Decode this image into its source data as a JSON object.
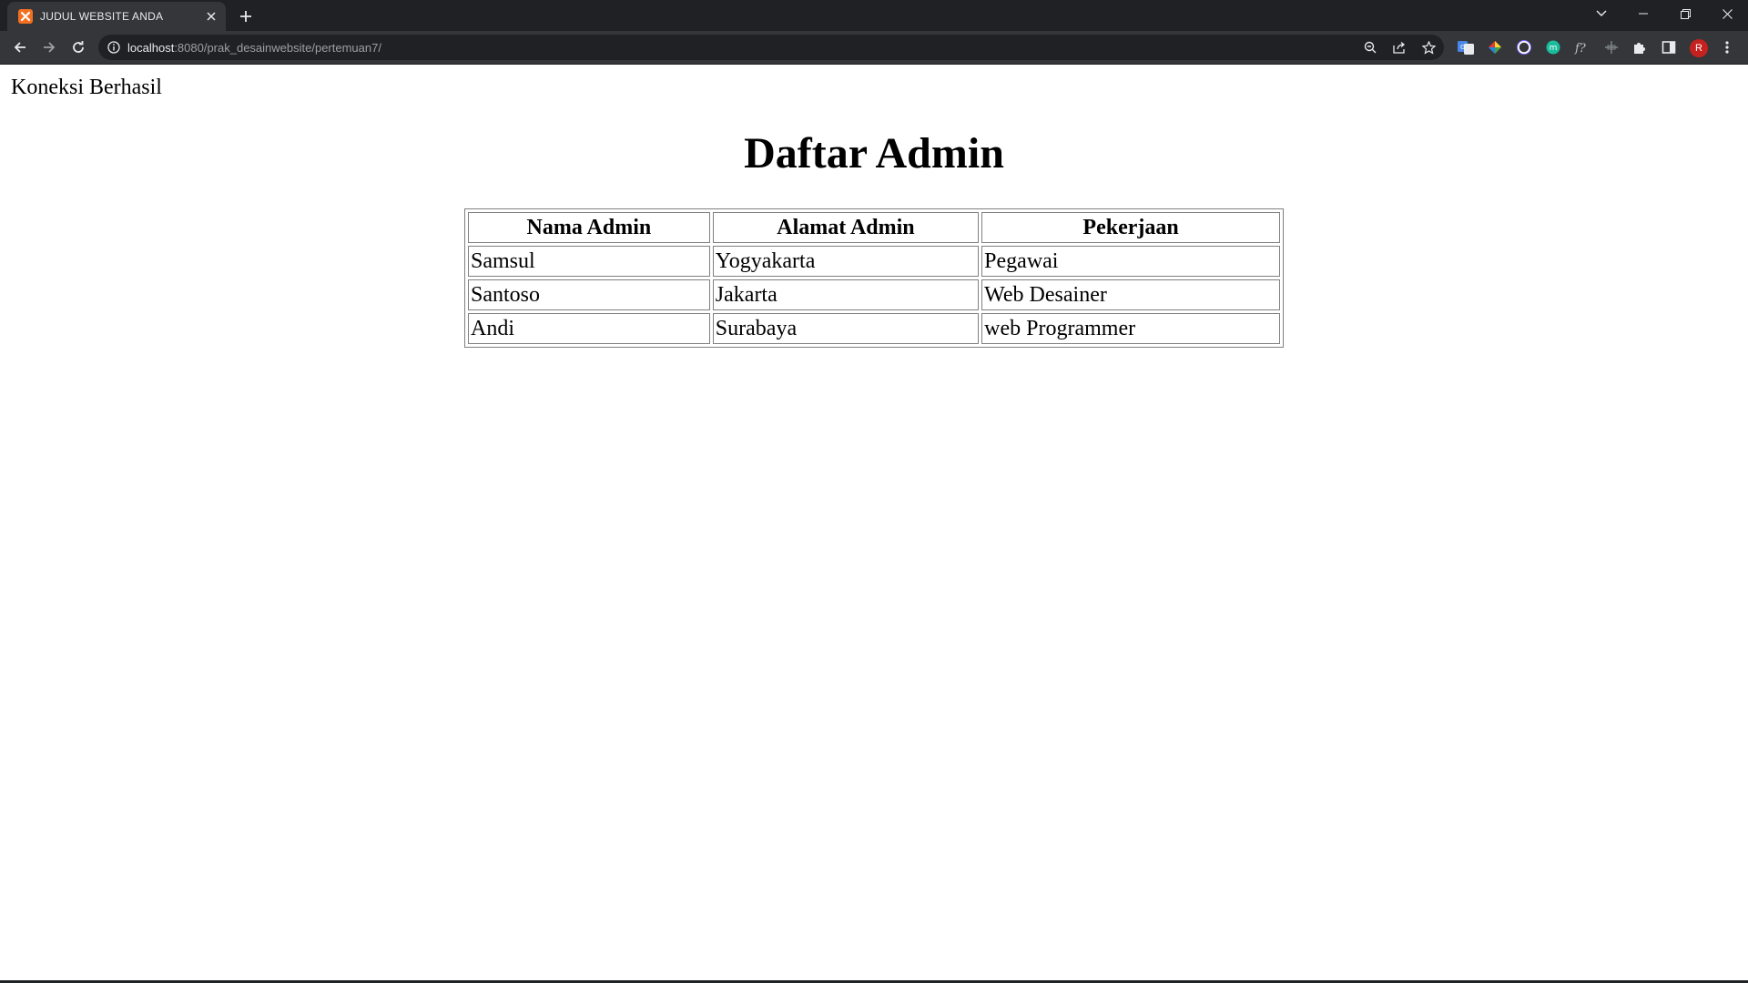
{
  "browser": {
    "tab_title": "JUDUL WEBSITE ANDA",
    "url_host": "localhost",
    "url_rest": ":8080/prak_desainwebsite/pertemuan7/",
    "avatar_letter": "R",
    "icons": {
      "favicon": "xampp-favicon-icon",
      "back": "arrow-left-icon",
      "forward": "arrow-right-icon",
      "reload": "reload-icon",
      "site_info": "info-icon",
      "zoom": "zoom-icon",
      "share": "share-icon",
      "bookmark": "star-icon",
      "extensions": [
        "translate-icon",
        "color-picker-icon",
        "circle-extension-icon",
        "m-extension-icon",
        "font-extension-icon",
        "ruler-extension-icon",
        "puzzle-icon",
        "side-panel-icon"
      ],
      "menu": "kebab-menu-icon"
    },
    "colors": {
      "frame": "#202124",
      "toolbar": "#35363a",
      "favicon": "#f37021",
      "avatar": "#c5221f"
    }
  },
  "page": {
    "status_text": "Koneksi Berhasil",
    "title": "Daftar Admin",
    "table": {
      "headers": [
        "Nama Admin",
        "Alamat Admin",
        "Pekerjaan"
      ],
      "rows": [
        [
          "Samsul",
          "Yogyakarta",
          "Pegawai"
        ],
        [
          "Santoso",
          "Jakarta",
          "Web Desainer"
        ],
        [
          "Andi",
          "Surabaya",
          "web Programmer"
        ]
      ]
    }
  }
}
